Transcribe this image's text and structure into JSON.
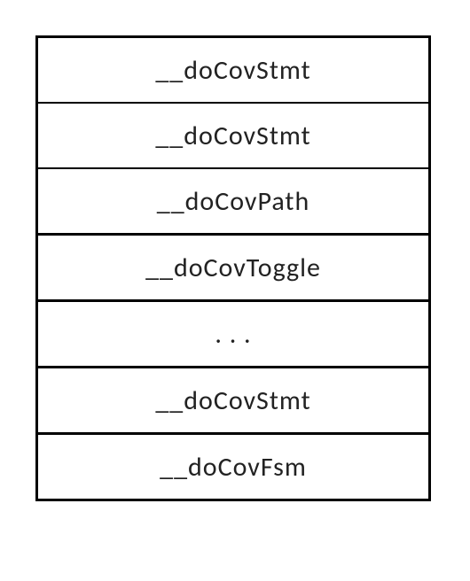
{
  "rows": [
    {
      "label": "__doCovStmt"
    },
    {
      "label": "__doCovStmt"
    },
    {
      "label": "__doCovPath"
    },
    {
      "label": "__doCovToggle"
    },
    {
      "label": ". . ."
    },
    {
      "label": "__doCovStmt"
    },
    {
      "label": "__doCovFsm"
    }
  ]
}
